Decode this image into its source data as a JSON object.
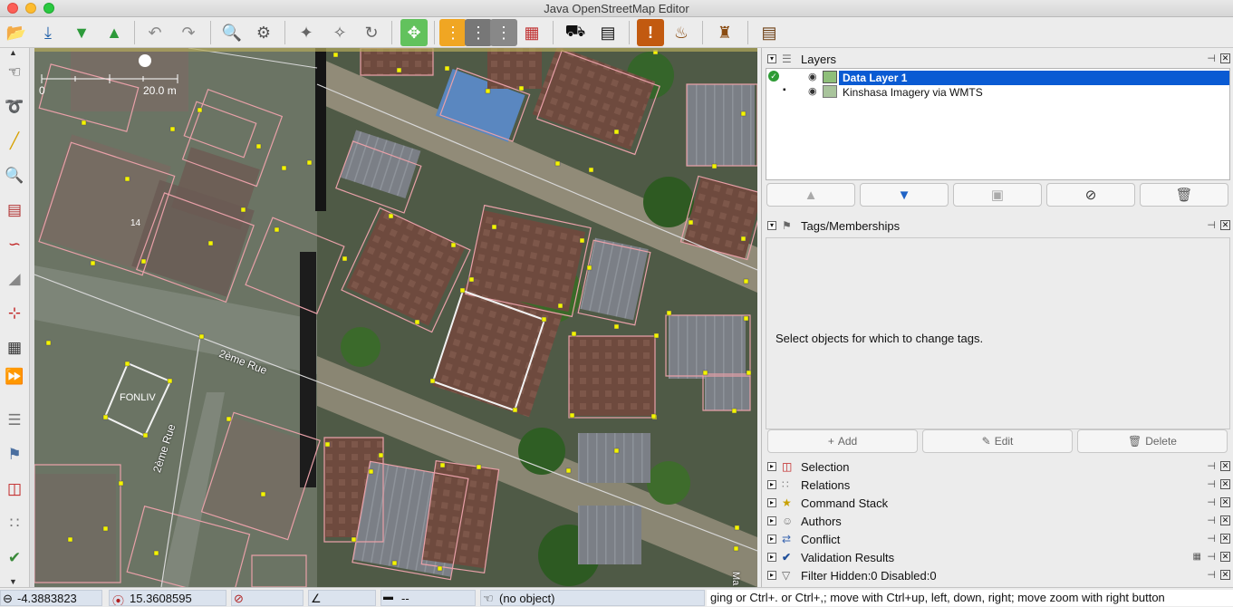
{
  "window": {
    "title": "Java OpenStreetMap Editor"
  },
  "toolbar": {
    "icons": [
      "open-file-icon",
      "save-icon",
      "download-icon",
      "upload-icon",
      "undo-icon",
      "redo-icon",
      "zoom-preview-icon",
      "preferences-icon",
      "split-way-icon",
      "combine-way-icon",
      "refresh-icon",
      "zoom-data-icon",
      "road-preset-icon",
      "rail-preset-icon",
      "track-preset-icon",
      "wall-preset-icon",
      "car-preset-icon",
      "bus-preset-icon",
      "warning-preset-icon",
      "restaurant-preset-icon",
      "castle-preset-icon",
      "factory-preset-icon"
    ]
  },
  "lefttools": {
    "icons": [
      "select-icon",
      "lasso-icon",
      "draw-icon",
      "zoom-icon",
      "delete-icon",
      "improve-way-icon",
      "parallel-icon",
      "extrude-icon",
      "building-tool-icon",
      "more-tools-icon",
      "layers-toggle-icon",
      "tags-toggle-icon",
      "selection-toggle-icon",
      "relations-toggle-icon",
      "validation-toggle-icon"
    ]
  },
  "map": {
    "scale_start": "0",
    "scale_end": "20.0 m",
    "labels": {
      "house_number": "14",
      "building": "FONLIV",
      "street_1": "2ème Rue",
      "street_2": "2ème Rue",
      "edge": "Ma"
    }
  },
  "layers": {
    "title": "Layers",
    "items": [
      {
        "name": "Data Layer 1",
        "active": true
      },
      {
        "name": "Kinshasa Imagery via WMTS",
        "active": false
      }
    ]
  },
  "tags": {
    "title": "Tags/Memberships",
    "message": "Select objects for which to change tags.",
    "add_label": "Add",
    "edit_label": "Edit",
    "delete_label": "Delete"
  },
  "panels": [
    {
      "title": "Selection"
    },
    {
      "title": "Relations"
    },
    {
      "title": "Command Stack"
    },
    {
      "title": "Authors"
    },
    {
      "title": "Conflict"
    },
    {
      "title": "Validation Results"
    },
    {
      "title": "Filter Hidden:0 Disabled:0"
    }
  ],
  "status": {
    "lat": "-4.3883823",
    "lon": "15.3608595",
    "heading": "",
    "angle": "",
    "length": "--",
    "object": "(no object)",
    "help": "ging or Ctrl+. or Ctrl+,; move with Ctrl+up, left, down, right; move zoom with right button"
  },
  "colors": {
    "selection": "#0a5bd3",
    "building_outline": "#e8a0a8",
    "node": "#f4f400",
    "status_field": "#dbe3ee"
  }
}
